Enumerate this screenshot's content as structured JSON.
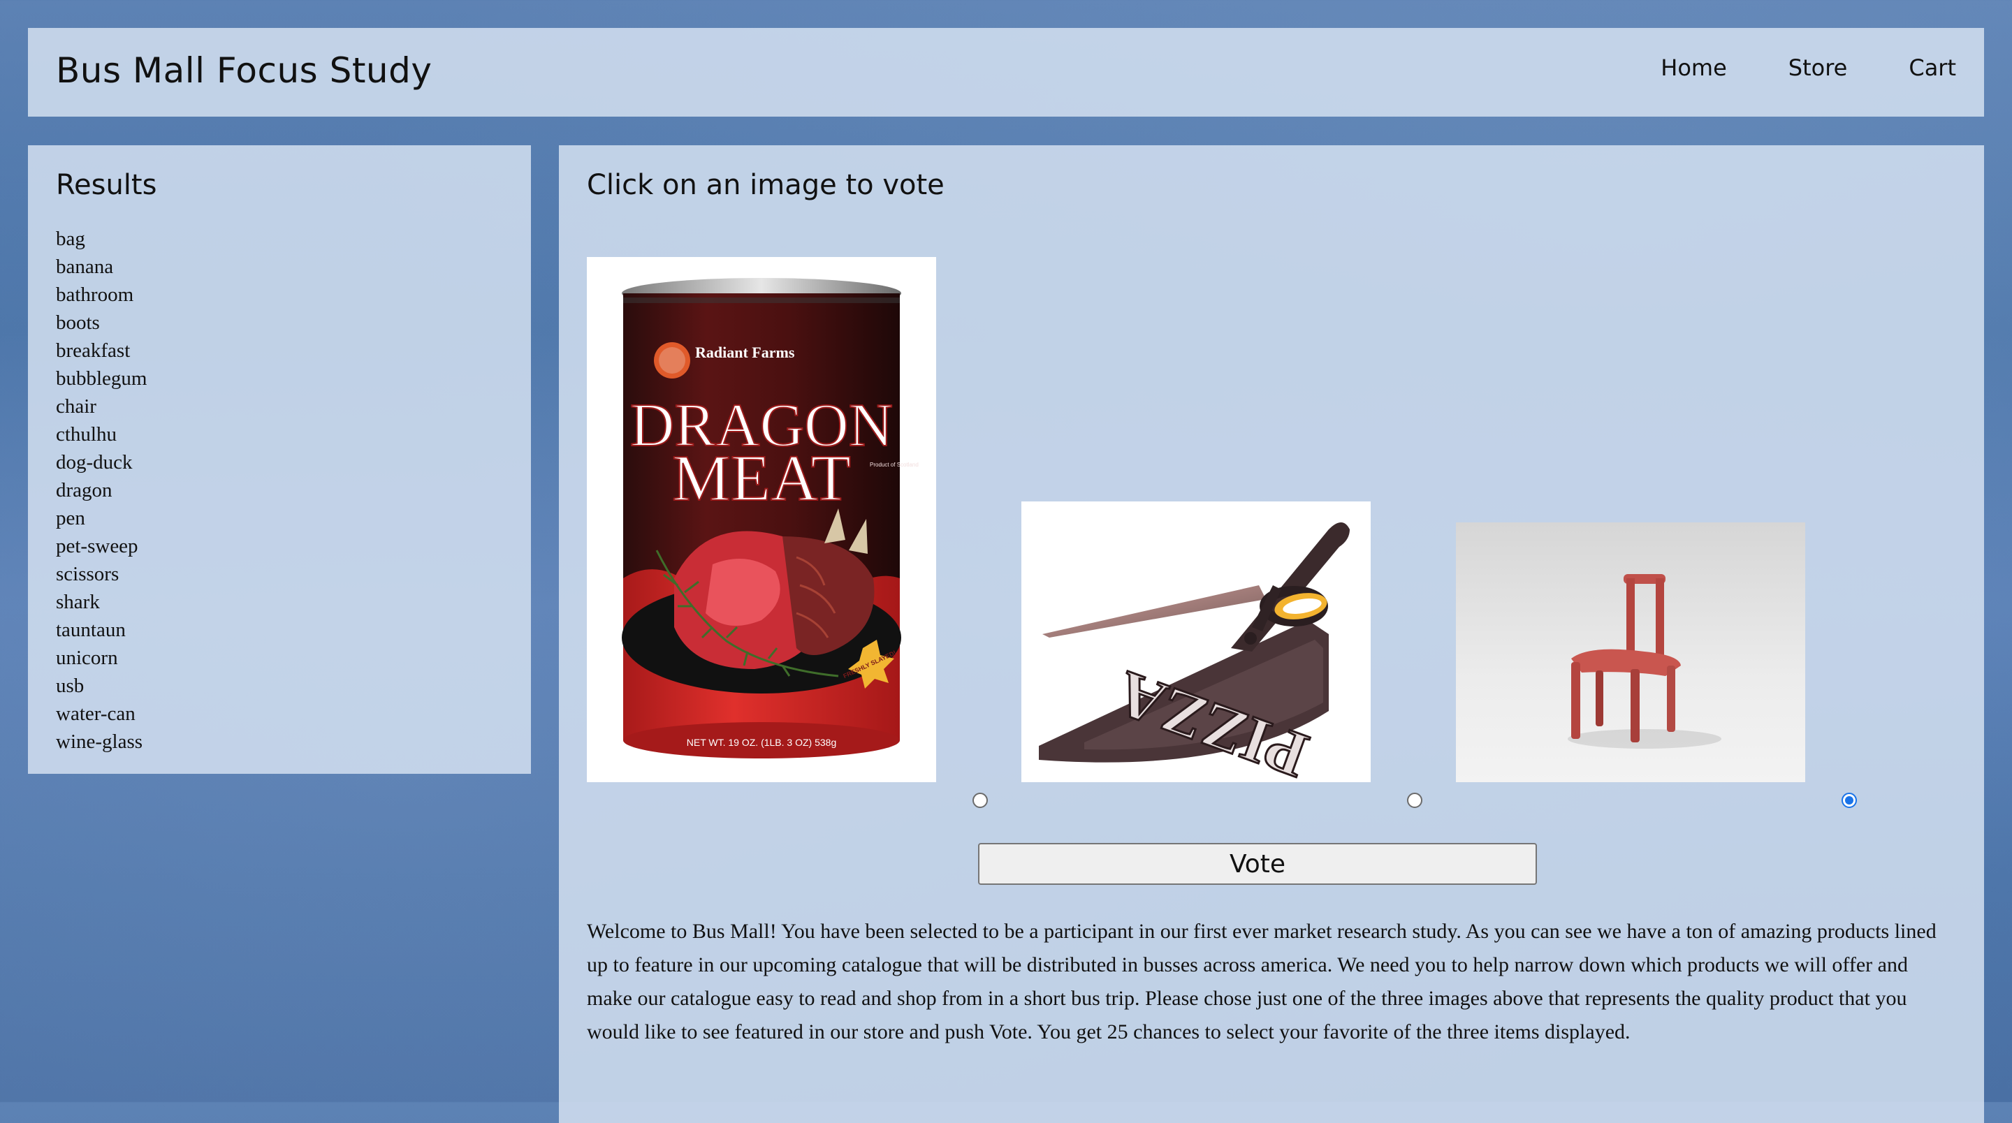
{
  "header": {
    "title": "Bus Mall Focus Study",
    "nav": [
      "Home",
      "Store",
      "Cart"
    ]
  },
  "results": {
    "heading": "Results",
    "items": [
      "bag",
      "banana",
      "bathroom",
      "boots",
      "breakfast",
      "bubblegum",
      "chair",
      "cthulhu",
      "dog-duck",
      "dragon",
      "pen",
      "pet-sweep",
      "scissors",
      "shark",
      "tauntaun",
      "unicorn",
      "usb",
      "water-can",
      "wine-glass"
    ]
  },
  "main": {
    "heading": "Click on an image to vote",
    "products": [
      {
        "name": "dragon",
        "brand": "Radiant Farms",
        "line1": "DRAGON",
        "line2": "MEAT",
        "badge": "FRESHLY SLAYED!",
        "net_weight": "NET WT. 19 OZ. (1LB. 3 OZ) 538g",
        "side": "Product of Scotland"
      },
      {
        "name": "scissors",
        "word": "PIZZA"
      },
      {
        "name": "chair"
      }
    ],
    "selected_index": 2,
    "vote_label": "Vote",
    "intro": "Welcome to Bus Mall! You have been selected to be a participant in our first ever market research study. As you can see we have a ton of amazing products lined up to feature in our upcoming catalogue that will be distributed in busses across america. We need you to help narrow down which products we will offer and make our catalogue easy to read and shop from in a short bus trip. Please chose just one of the three images above that represents the quality product that you would like to see featured in our store and push Vote. You get 25 chances to select your favorite of the three items displayed."
  },
  "colors": {
    "panel": "#d3e0f0",
    "background": "#4e76aa",
    "radio_selected": "#1a73e8"
  }
}
